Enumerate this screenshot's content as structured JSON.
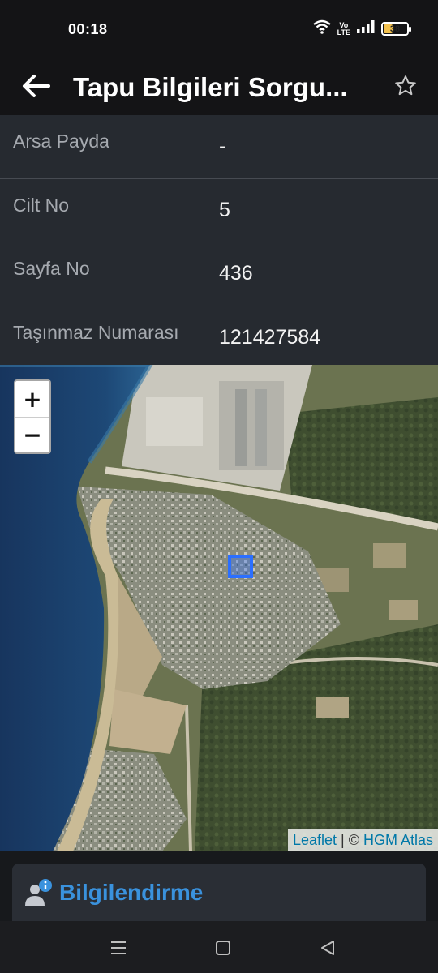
{
  "status_bar": {
    "time": "00:18",
    "battery": "38",
    "network_label_top": "Vo",
    "network_label_bottom": "LTE",
    "icons": [
      "wifi-icon",
      "volte-icon",
      "signal-icon",
      "battery-icon"
    ]
  },
  "app_bar": {
    "title": "Tapu Bilgileri Sorgu...",
    "back_icon": "arrow-left-icon",
    "favorite_icon": "star-outline-icon"
  },
  "info_rows": [
    {
      "label": "Arsa Payda",
      "value": "-"
    },
    {
      "label": "Cilt No",
      "value": "5"
    },
    {
      "label": "Sayfa No",
      "value": "436"
    },
    {
      "label": "Taşınmaz Numarası",
      "value": "121427584"
    }
  ],
  "map": {
    "zoom_in": "+",
    "zoom_out": "−",
    "attribution_link1": "Leaflet",
    "attribution_sep": " | © ",
    "attribution_link2": "HGM Atlas",
    "parcel_color": "#2b6fff"
  },
  "info_card": {
    "title": "Bilgilendirme",
    "icon": "user-info-icon",
    "accent_color": "#3a92dd"
  },
  "nav_bar": {
    "icons": [
      "menu-icon",
      "home-square-icon",
      "back-triangle-icon"
    ]
  }
}
